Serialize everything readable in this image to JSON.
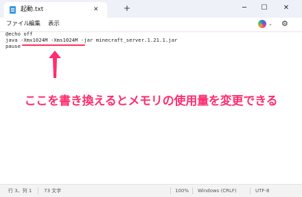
{
  "window": {
    "tab_title": "起動.txt",
    "tab_close": "✕",
    "new_tab": "+",
    "minimize": "─",
    "maximize": "☐",
    "close": "✕"
  },
  "menu": {
    "items": [
      "ファイル",
      "編集",
      "表示"
    ]
  },
  "editor": {
    "lines": [
      "@echo off",
      "java -Xmx1024M -Xms1024M -jar minecraft_server.1.21.1.jar",
      "pause"
    ]
  },
  "annotation": {
    "text": "ここを書き換えるとメモリの使用量を変更できる",
    "color": "#ff2d6f"
  },
  "status": {
    "position": "行 3、列 1",
    "chars": "73 文字",
    "zoom": "100%",
    "line_ending": "Windows (CRLF)",
    "encoding": "UTF-8"
  },
  "icons": {
    "tab": "notepad-icon",
    "copilot": "copilot-icon",
    "settings": "gear-icon",
    "arrow": "arrow-up-icon"
  }
}
